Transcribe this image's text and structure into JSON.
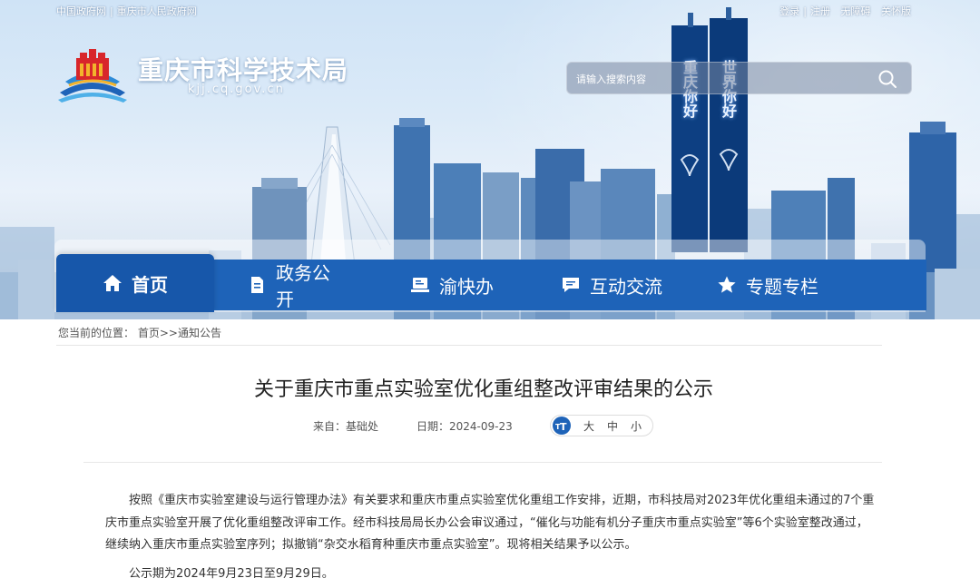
{
  "topbar": {
    "links_left": [
      "中国政府网",
      "重庆市人民政府网"
    ],
    "links_right": [
      "登录",
      "注册",
      "无障碍",
      "关怀版"
    ]
  },
  "site": {
    "title": "重庆市科学技术局",
    "domain": "kjj.cq.gov.cn"
  },
  "search": {
    "placeholder": "请输入搜索内容"
  },
  "nav": {
    "items": [
      {
        "label": "首页",
        "icon": "home-icon"
      },
      {
        "label": "政务公开",
        "icon": "document-icon"
      },
      {
        "label": "渝快办",
        "icon": "desk-icon"
      },
      {
        "label": "互动交流",
        "icon": "chat-icon"
      },
      {
        "label": "专题专栏",
        "icon": "star-icon"
      }
    ]
  },
  "tower_text": [
    "重庆你好",
    "世界你好"
  ],
  "breadcrumb": {
    "prefix": "您当前的位置：",
    "home": "首页",
    "sep": ">>",
    "current": "通知公告"
  },
  "article": {
    "title": "关于重庆市重点实验室优化重组整改评审结果的公示",
    "source_label": "来自：",
    "source": "基础处",
    "date_label": "日期：",
    "date": "2024-09-23",
    "font_sizes": [
      "大",
      "中",
      "小"
    ],
    "paragraphs": [
      "按照《重庆市实验室建设与运行管理办法》有关要求和重庆市重点实验室优化重组工作安排，近期，市科技局对2023年优化重组未通过的7个重庆市重点实验室开展了优化重组整改评审工作。经市科技局局长办公会审议通过，“催化与功能有机分子重庆市重点实验室”等6个实验室整改通过，继续纳入重庆市重点实验室序列；拟撤销“杂交水稻育种重庆市重点实验室”。现将相关结果予以公示。",
      "公示期为2024年9月23日至9月29日。"
    ]
  },
  "colors": {
    "nav_bg": "#1e63b8",
    "nav_active": "#1757aa",
    "logo_red": "#d8262b",
    "logo_gold": "#f2b42c"
  }
}
